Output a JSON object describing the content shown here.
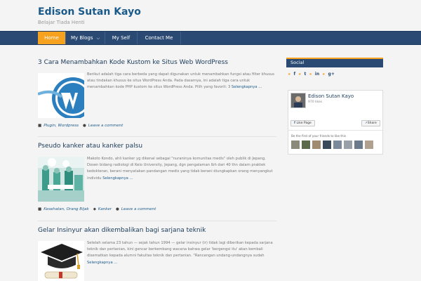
{
  "site": {
    "title": "Edison Sutan Kayo",
    "tagline": "Belajar Tiada Henti"
  },
  "nav": {
    "items": [
      {
        "label": "Home",
        "active": true
      },
      {
        "label": "My Blogs",
        "has_dropdown": true
      },
      {
        "label": "My Self"
      },
      {
        "label": "Contact Me"
      }
    ]
  },
  "posts": [
    {
      "title": "3 Cara Menambahkan Kode Kustom ke Situs Web WordPress",
      "excerpt": "Berikut adalah tiga cara berbeda yang dapat digunakan untuk menambahkan fungsi atau filter khusus atau tindakan khusus ke situs WordPress Anda. Pada dasarnya, ini adalah tiga cara untuk menambahkan kode PHP kustom ke situs WordPress Anda. Pilih yang favorit: 3",
      "more": "Selengkapnya …",
      "tags_icon": "folder-icon",
      "categories": "Plugin, Wordpress",
      "comment": "Leave a comment",
      "thumb": "wordpress-logo-image"
    },
    {
      "title": "Pseudo kanker atau kanker palsu",
      "excerpt": "Makoto Kondo, ahli kanker yg dikenal sebagai \"nuraninya komunitas medis\" oleh publik di Jepang. Dosen bidang radiologi di Keio University, Jepang, dgn pengalaman lbh dari 40 thn dalam praktek kedokteran, berani menyatakan pandangan medis yang tidak berani diungkapkan orang menyangkut individu",
      "more": "Selengkapnya …",
      "categories": "Kesehatan, Orang Bijak",
      "tag": "Kanker",
      "comment": "Leave a comment",
      "thumb": "medical-team-image"
    },
    {
      "title": "Gelar Insinyur akan dikembalikan bagi sarjana teknik",
      "excerpt": "Setelah selama 23 tahun — sejak tahun 1994 — gelar insinyur (ir) tidak lagi diberikan kepada sarjana teknik dan pertanian, kini gencar berkembang wacana bahwa gelar 'bergengsi itu' akan kembali disematkan kepada alumni fakultas teknik dan pertanian. \"Rancangan undang-undangnya sudah",
      "more": "Selengkapnya …",
      "thumb": "graduation-cap-image"
    }
  ],
  "sidebar": {
    "social_title": "Social",
    "social_icons": [
      "facebook-icon",
      "twitter-icon",
      "linkedin-icon",
      "google-plus-icon"
    ],
    "social_glyphs": [
      "f",
      "t",
      "in",
      "g+"
    ],
    "fb_box": {
      "name": "Edison Sutan Kayo",
      "likes": "970 likes",
      "like_button": "Like Page",
      "share_button": "Share",
      "friends_text": "Be the first of your friends to like this",
      "face_count": 8
    }
  },
  "colors": {
    "nav_bg": "#2a4a73",
    "accent": "#f6a21e",
    "link": "#1a5a8a"
  }
}
